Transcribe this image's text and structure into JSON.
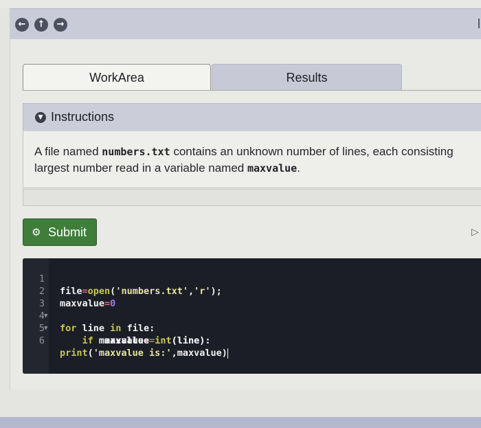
{
  "nav": {
    "back_icon": "arrow-left-circle-icon",
    "up_icon": "arrow-up-circle-icon",
    "forward_icon": "arrow-right-circle-icon"
  },
  "tabs": [
    {
      "label": "WorkArea",
      "active": true
    },
    {
      "label": "Results",
      "active": false
    }
  ],
  "instructions": {
    "title": "Instructions",
    "icon": "chevron-down-circle-icon",
    "line1_a": "A file named ",
    "line1_code": "numbers.txt",
    "line1_b": " contains an unknown number of lines, each consisting",
    "line2_a": "largest number read in a variable named ",
    "line2_code": "maxvalue",
    "line2_b": "."
  },
  "submit": {
    "label": "Submit",
    "icon": "gear-icon"
  },
  "editor": {
    "line_numbers": [
      "1",
      "2",
      "3",
      "4",
      "5",
      "6"
    ],
    "code": [
      "file=open('numbers.txt','r');",
      "maxvalue=0",
      "for line in file:",
      "    if maxvalue<=int(line):",
      "        maxvalue=int(line)",
      "print('maxvalue is:',maxvalue)"
    ]
  },
  "colors": {
    "nav_bar": "#c9cbd9",
    "tab_inactive": "#c7c9d7",
    "instructions_header": "#cbcdd9",
    "submit_button": "#3f7d3b",
    "editor_background": "#1c1e27",
    "keyword": "#c6c84e",
    "operator": "#e0647a",
    "number": "#9c7bf0"
  }
}
